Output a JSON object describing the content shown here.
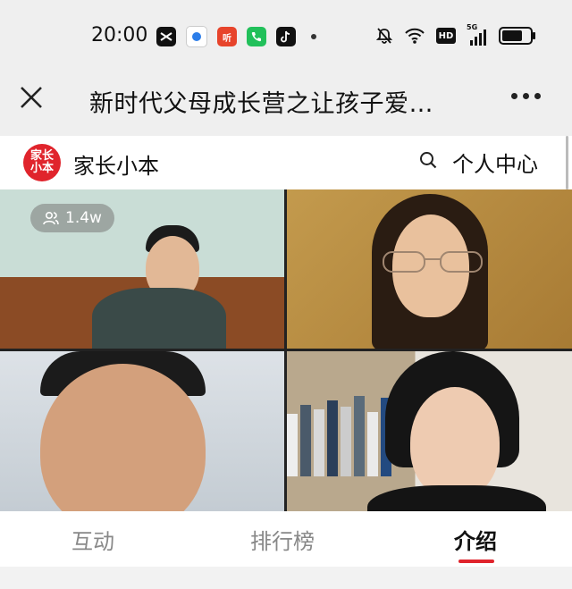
{
  "status_bar": {
    "time": "20:00",
    "apps": [
      "capcut-icon",
      "browser-icon",
      "listen-app-icon",
      "phone-icon",
      "tiktok-icon"
    ],
    "listen_app_text": "听",
    "hd_label": "HD",
    "network_label": "5G"
  },
  "header": {
    "title": "新时代父母成长营之让孩子爱…"
  },
  "channel": {
    "name": "家长小本",
    "logo_text": "家长小本",
    "profile_link": "个人中心"
  },
  "video": {
    "viewer_count": "1.4w"
  },
  "tabs": [
    {
      "label": "互动",
      "active": false
    },
    {
      "label": "排行榜",
      "active": false
    },
    {
      "label": "介绍",
      "active": true
    }
  ],
  "colors": {
    "accent": "#e0242c",
    "status_bar_bg": "#efefef"
  }
}
